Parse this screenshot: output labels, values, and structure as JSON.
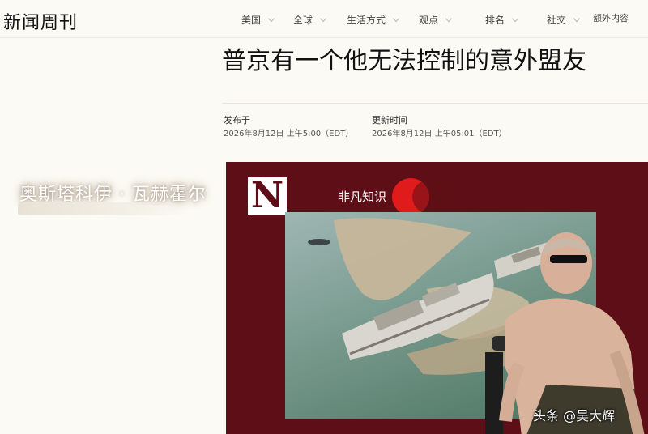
{
  "header": {
    "logo": "新闻周刊",
    "nav": [
      "美国",
      "全球",
      "生活方式",
      "观点",
      "排名",
      "社交"
    ],
    "extra": "额外内容"
  },
  "article": {
    "headline": "普京有一个他无法控制的意外盟友",
    "published_label": "发布于",
    "published_value": "2026年8月12日 上午5:00（EDT）",
    "updated_label": "更新时间",
    "updated_value": "2026年8月12日 上午05:01（EDT）"
  },
  "author": {
    "name": "奥斯塔科伊 · 瓦赫霍尔"
  },
  "image": {
    "logo_letter": "N",
    "brand_text": "非凡知识",
    "watermark": "头条 @吴大辉"
  },
  "colors": {
    "panel": "#5e0e16",
    "accent_red": "#e01b1b",
    "page_bg": "#fbfaf4"
  }
}
